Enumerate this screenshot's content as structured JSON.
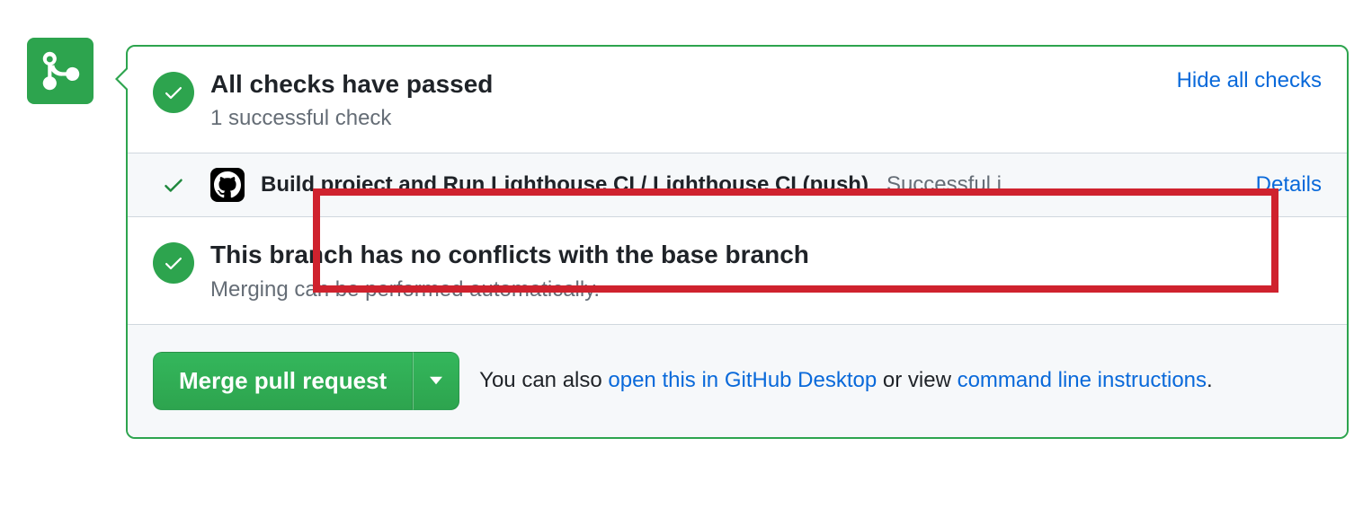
{
  "checks": {
    "title": "All checks have passed",
    "subtitle": "1 successful check",
    "toggle_label": "Hide all checks",
    "items": [
      {
        "name": "Build project and Run Lighthouse CI / Lighthouse CI (push)",
        "status": "Successful i…",
        "details_label": "Details"
      }
    ]
  },
  "conflicts": {
    "title": "This branch has no conflicts with the base branch",
    "subtitle": "Merging can be performed automatically."
  },
  "merge": {
    "button_label": "Merge pull request",
    "hint_prefix": "You can also ",
    "desktop_link": "open this in GitHub Desktop",
    "hint_middle": " or view ",
    "cli_link": "command line instructions",
    "hint_suffix": "."
  }
}
